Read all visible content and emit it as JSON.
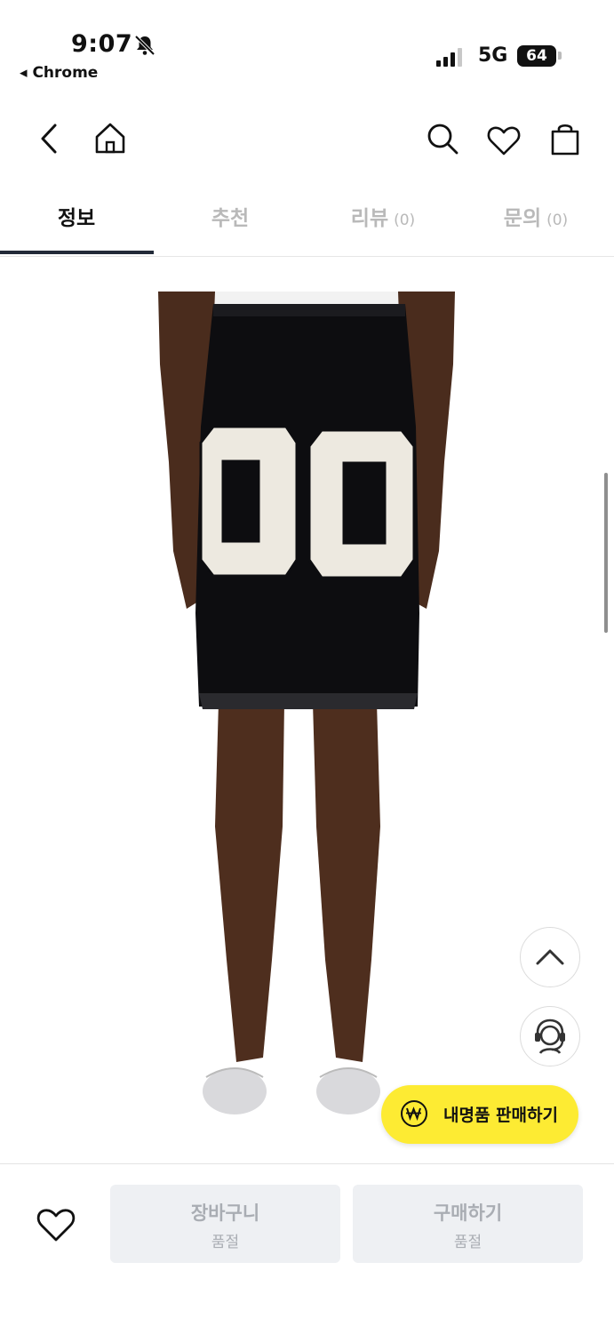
{
  "status": {
    "time": "9:07",
    "back_app": "Chrome",
    "network": "5G",
    "battery": "64"
  },
  "tabs": [
    {
      "label": "정보",
      "count": ""
    },
    {
      "label": "추천",
      "count": ""
    },
    {
      "label": "리뷰",
      "count": "(0)"
    },
    {
      "label": "문의",
      "count": "(0)"
    }
  ],
  "product_image": {
    "number_print": "00"
  },
  "sell_button": {
    "label": "내명품 판매하기",
    "color": "#fdeb33"
  },
  "bottom_bar": {
    "cart": {
      "label": "장바구니",
      "status": "품절"
    },
    "buy": {
      "label": "구매하기",
      "status": "품절"
    }
  },
  "icons": [
    "chevron-left-icon",
    "home-icon",
    "search-icon",
    "heart-icon",
    "shopping-bag-icon",
    "chevron-up-icon",
    "headset-agent-icon",
    "won-icon",
    "bell-slash-icon"
  ]
}
